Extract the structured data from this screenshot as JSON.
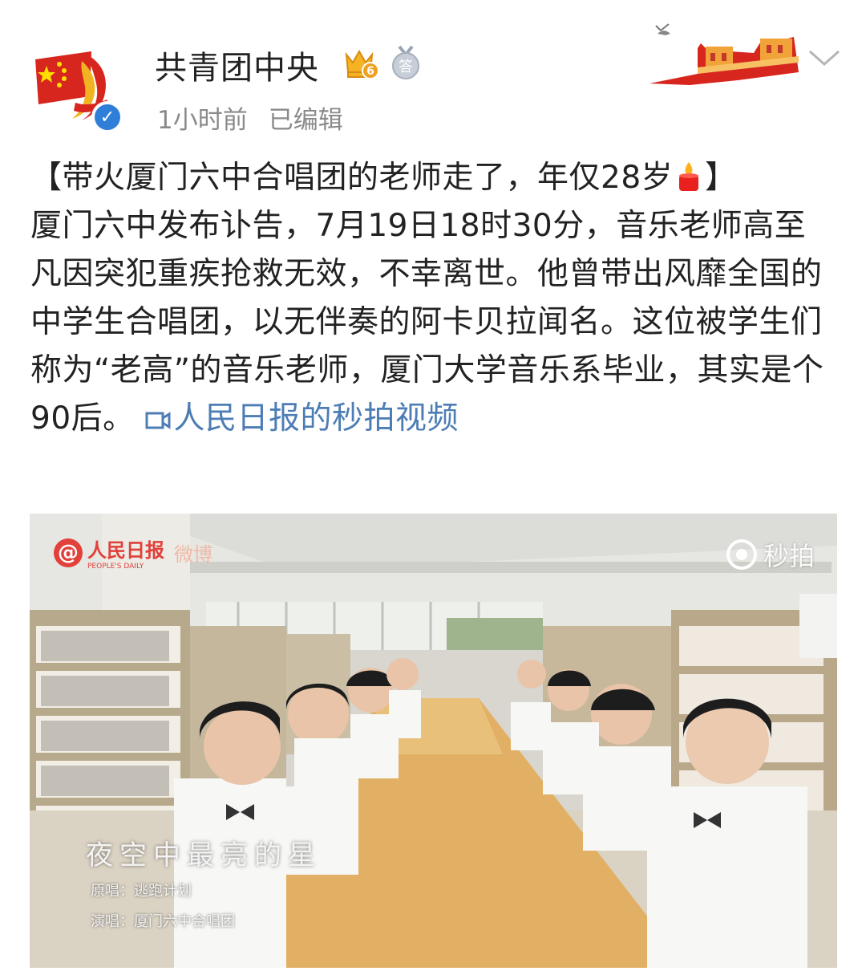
{
  "author": {
    "name": "共青团中央",
    "crown_level": "6",
    "answer_badge": "答",
    "verified_mark": "✓"
  },
  "post_meta": {
    "time": "1小时前",
    "edited": "已编辑"
  },
  "post": {
    "title": "【带火厦门六中合唱团的老师走了，年仅28岁",
    "title_end": "】",
    "body": "厦门六中发布讣告，7月19日18时30分，音乐老师高至凡因突犯重疾抢救无效，不幸离世。他曾带出风靡全国的中学生合唱团，以无伴奏的阿卡贝拉闻名。这位被学生们称为“老高”的音乐老师，厦门大学音乐系毕业，其实是个90后。",
    "video_link": "人民日报的秒拍视频"
  },
  "video": {
    "watermark_brand": "人民日报",
    "watermark_brand_en": "PEOPLE'S DAILY",
    "watermark_weibo": "微博",
    "watermark_player": "秒拍",
    "song_title": "夜空中最亮的星",
    "original_singer": "原唱：逃跑计划",
    "performer": "演唱：厦门六中合唱团"
  },
  "colors": {
    "link": "#4d7db5",
    "meta_gray": "#8a8a8a",
    "verified_blue": "#2f7ed8",
    "flag_red": "#d7261e"
  }
}
